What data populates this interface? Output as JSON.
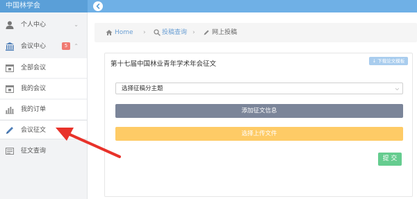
{
  "app": {
    "title": "中国林学会"
  },
  "sidebar": {
    "items": [
      {
        "label": "个人中心",
        "icon": "user-icon",
        "chevron": "⌄"
      },
      {
        "label": "会议中心",
        "icon": "institution-icon",
        "badge": "5",
        "chevron": "⌃"
      },
      {
        "label": "全部会议",
        "icon": "calendar-icon"
      },
      {
        "label": "我的会议",
        "icon": "calendar-icon"
      },
      {
        "label": "我的订单",
        "icon": "bar-chart-icon"
      },
      {
        "label": "会议征文",
        "icon": "pencil-icon"
      },
      {
        "label": "征文查询",
        "icon": "list-icon"
      }
    ]
  },
  "breadcrumb": {
    "home": "Home",
    "sep": "›",
    "level2": "投稿查询",
    "current": "网上投稿"
  },
  "panel": {
    "title": "第十七届中国林业青年学术年会征文",
    "download_label": "下载论文模板",
    "select_value": "选择征稿分主题",
    "add_label": "添加征文信息",
    "upload_label": "选择上传文件",
    "submit_label": "提 交"
  },
  "colors": {
    "topbar": "#6fb0e6",
    "badge": "#f07a72",
    "add_button": "#7b8599",
    "upload_button": "#fecb66",
    "submit_button": "#65cc8f",
    "annotation_arrow": "#e8322a"
  }
}
